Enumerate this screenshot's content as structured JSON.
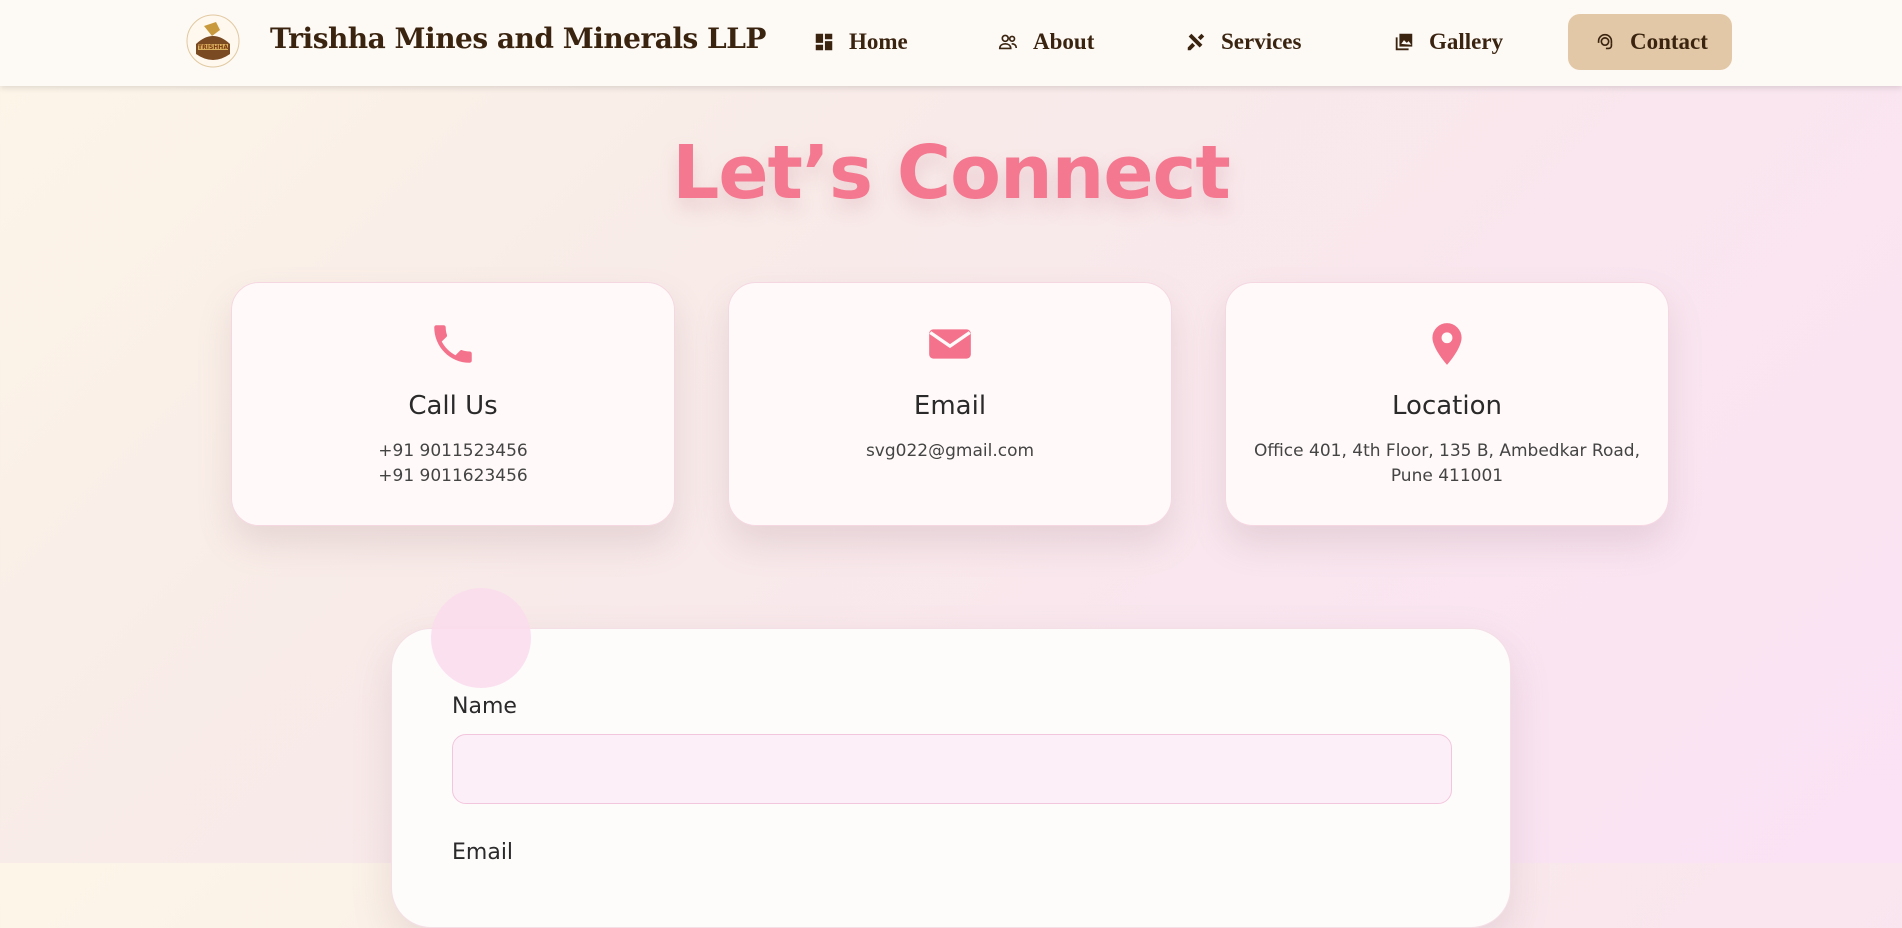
{
  "header": {
    "brand": "Trishha Mines and Minerals LLP",
    "logo_text": "TRISHHA",
    "nav": [
      {
        "label": "Home",
        "icon": "dashboard-icon"
      },
      {
        "label": "About",
        "icon": "people-icon"
      },
      {
        "label": "Services",
        "icon": "tools-icon"
      },
      {
        "label": "Gallery",
        "icon": "image-icon"
      },
      {
        "label": "Contact",
        "icon": "support-agent-icon",
        "active": true
      }
    ]
  },
  "hero": {
    "title": "Let’s Connect"
  },
  "cards": [
    {
      "icon": "phone-icon",
      "title": "Call Us",
      "lines": [
        "+91 9011523456",
        "+91 9011623456"
      ]
    },
    {
      "icon": "envelope-icon",
      "title": "Email",
      "lines": [
        "svg022@gmail.com"
      ]
    },
    {
      "icon": "location-pin-icon",
      "title": "Location",
      "lines": [
        "Office 401, 4th Floor, 135 B, Ambedkar Road,",
        "Pune 411001"
      ]
    }
  ],
  "form": {
    "name_label": "Name",
    "name_value": "",
    "email_label": "Email"
  },
  "colors": {
    "accent": "#f4788f",
    "nav_text": "#3a2410",
    "active_nav_bg": "#e2c8a6",
    "input_bg": "#fdeff7"
  }
}
